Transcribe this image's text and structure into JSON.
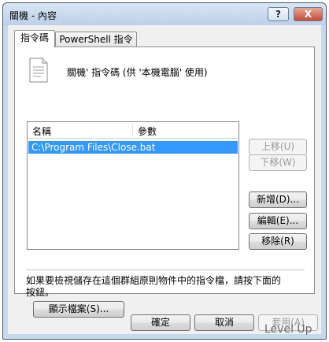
{
  "window": {
    "title": "關機 - 內容",
    "help_label": "?",
    "close_label": "X"
  },
  "tabs": [
    {
      "label": "指令碼",
      "selected": true
    },
    {
      "label": "PowerShell 指令碼",
      "selected": false
    }
  ],
  "header": {
    "icon": "script-file-icon",
    "description": "關機' 指令碼 (供 '本機電腦' 使用)"
  },
  "list": {
    "columns": [
      "名稱",
      "參數"
    ],
    "rows": [
      {
        "name": "C:\\Program Files\\Close.bat",
        "params": "",
        "selected": true
      }
    ]
  },
  "side_buttons": {
    "move_up": "上移(U)",
    "move_down": "下移(W)",
    "add": "新增(D)...",
    "edit": "編輯(E)...",
    "remove": "移除(R)"
  },
  "info_text": "如果要檢視儲存在這個群組原則物件中的指令檔，請按下面的按鈕。",
  "show_files_label": "顯示檔案(S)...",
  "footer": {
    "ok": "確定",
    "cancel": "取消",
    "apply": "套用(A)"
  },
  "watermark": "Level Up"
}
